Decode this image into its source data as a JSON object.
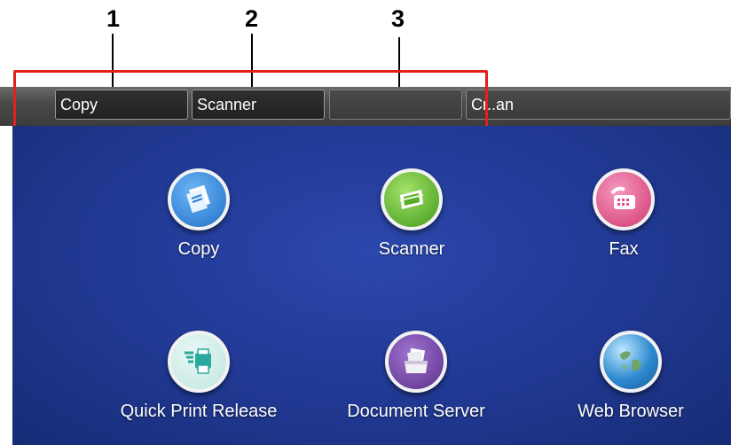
{
  "callouts": [
    "1",
    "2",
    "3"
  ],
  "topbar": {
    "slots": [
      {
        "label": "Copy"
      },
      {
        "label": "Scanner"
      },
      {
        "label": ""
      },
      {
        "label": "Cr..an"
      }
    ]
  },
  "apps": [
    {
      "label": "Copy",
      "icon": "copy-icon",
      "color": "#2a7fd6"
    },
    {
      "label": "Scanner",
      "icon": "scanner-icon",
      "color": "#5aad2b"
    },
    {
      "label": "Fax",
      "icon": "fax-icon",
      "color": "#e0508a"
    },
    {
      "label": "Quick Print Release",
      "icon": "print-release-icon",
      "color": "#2aa99e"
    },
    {
      "label": "Document Server",
      "icon": "document-server-icon",
      "color": "#6e3fa0"
    },
    {
      "label": "Web Browser",
      "icon": "globe-icon",
      "color": "#2d8ad0"
    }
  ]
}
